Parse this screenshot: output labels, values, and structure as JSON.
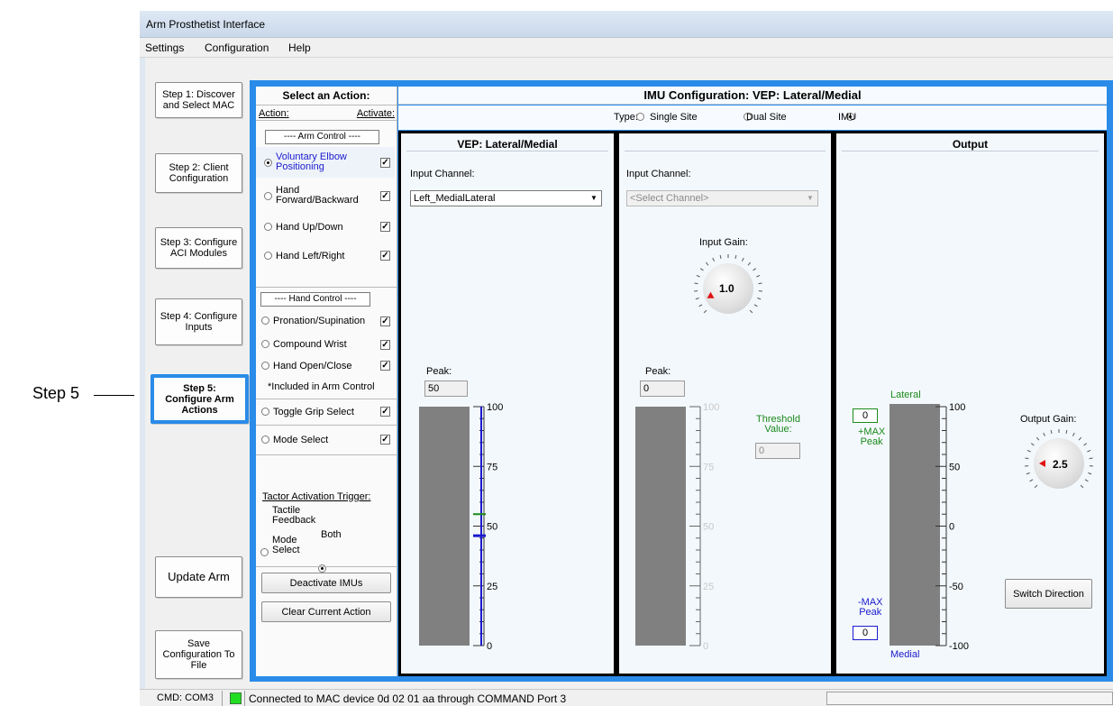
{
  "annotation": {
    "label": "Step 5"
  },
  "window": {
    "title": "Arm Prosthetist Interface"
  },
  "menu": [
    "Settings",
    "Configuration",
    "Help"
  ],
  "steps": [
    "Step 1: Discover\nand Select MAC",
    "Step 2: Client\nConfiguration",
    "Step 3: Configure\nACI Modules",
    "Step 4: Configure\nInputs",
    "Step 5:\nConfigure Arm\nActions",
    "Update Arm",
    "Save\nConfiguration To\nFile"
  ],
  "active_step_index": 4,
  "action_panel": {
    "title": "Select an Action:",
    "col_action": "Action:",
    "col_activate": "Activate:",
    "arm_group": "---- Arm Control ----",
    "arm_items": [
      {
        "label": "Voluntary Elbow\nPositioning",
        "selected": true,
        "checked": true
      },
      {
        "label": "Hand\nForward/Backward",
        "selected": false,
        "checked": true
      },
      {
        "label": "Hand Up/Down",
        "selected": false,
        "checked": true
      },
      {
        "label": "Hand Left/Right",
        "selected": false,
        "checked": true
      }
    ],
    "hand_group": "---- Hand Control ----",
    "hand_items": [
      {
        "label": "Pronation/Supination",
        "checked": true
      },
      {
        "label": "Compound Wrist",
        "checked": true
      },
      {
        "label": "Hand Open/Close",
        "checked": true
      }
    ],
    "note": "*Included in Arm Control",
    "other_items": [
      {
        "label": "Toggle Grip Select",
        "checked": true
      },
      {
        "label": "Mode Select",
        "checked": true
      }
    ],
    "tactor_title": "Tactor Activation Trigger:",
    "tactor_opt1": "Tactile\nFeedback",
    "tactor_opt2": "Mode\nSelect",
    "tactor_both": "Both",
    "deactivate_btn": "Deactivate IMUs",
    "clear_btn": "Clear Current Action"
  },
  "main": {
    "title": "IMU Configuration: VEP: Lateral/Medial",
    "type_label": "Type:",
    "type_options": [
      "Single Site",
      "Dual Site",
      "IMU"
    ],
    "type_selected": 2
  },
  "panel1": {
    "title": "VEP: Lateral/Medial",
    "input_label": "Input Channel:",
    "channel": "Left_MedialLateral",
    "peak_label": "Peak:",
    "peak_value": "50",
    "scale": [
      "100",
      "75",
      "50",
      "25",
      "0"
    ],
    "green_marker": 55,
    "blue_marker": 46
  },
  "panel2": {
    "title": "",
    "input_label": "Input Channel:",
    "channel": "<Select Channel>",
    "gain_label": "Input Gain:",
    "gain_value": "1.0",
    "peak_label": "Peak:",
    "peak_value": "0",
    "threshold_label": "Threshold\nValue:",
    "threshold_value": "0",
    "scale": [
      "100",
      "75",
      "50",
      "25",
      "0"
    ]
  },
  "panel3": {
    "title": "Output",
    "top_label": "Lateral",
    "bottom_label": "Medial",
    "max_pos_value": "0",
    "max_pos_label": "+MAX\nPeak",
    "max_neg_label": "-MAX\nPeak",
    "max_neg_value": "0",
    "scale": [
      "100",
      "50",
      "0",
      "-50",
      "-100"
    ],
    "gain_label": "Output Gain:",
    "gain_value": "2.5",
    "switch_btn": "Switch Direction"
  },
  "status": {
    "port": "CMD: COM3",
    "message": "Connected to MAC device 0d 02 01 aa through COMMAND Port 3"
  },
  "colors": {
    "accent": "#2a8be8",
    "green": "#1a8a1a",
    "blue": "#1a1acc",
    "indicator": "#22dd22"
  }
}
